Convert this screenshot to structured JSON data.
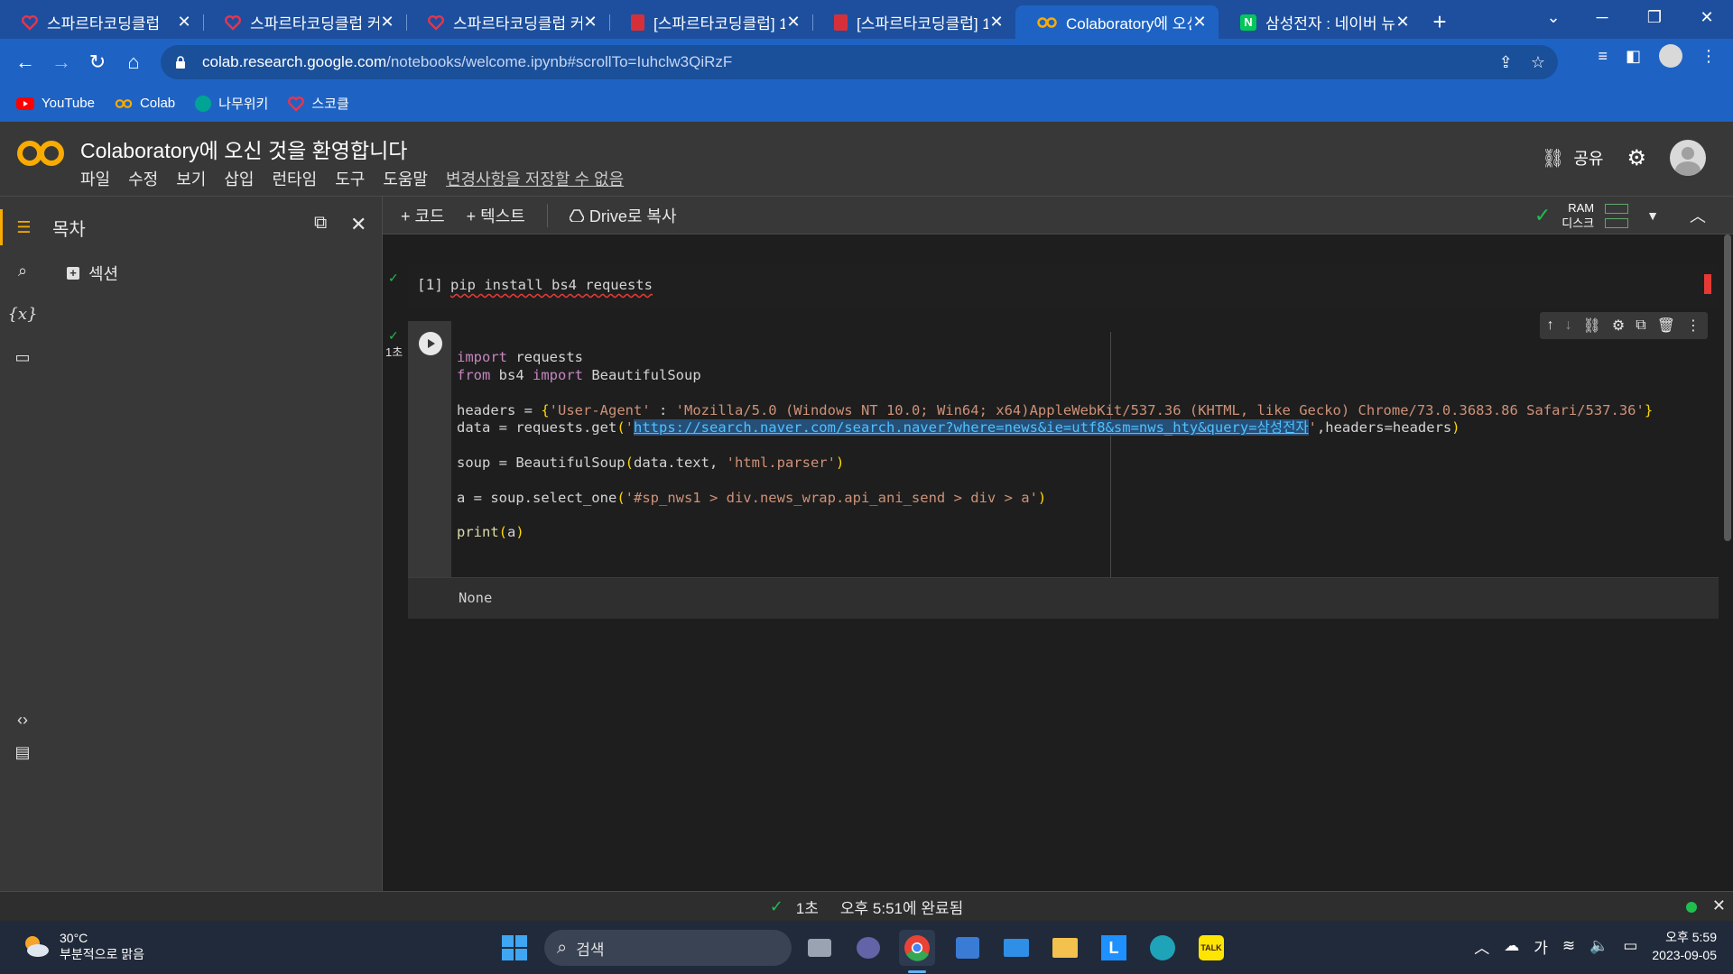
{
  "browser": {
    "tabs": [
      {
        "title": "스파르타코딩클럽",
        "icon": "sparta-heart-icon"
      },
      {
        "title": "스파르타코딩클럽 커",
        "icon": "sparta-heart-icon"
      },
      {
        "title": "스파르타코딩클럽 커",
        "icon": "sparta-heart-icon"
      },
      {
        "title": "[스파르타코딩클럽] 1",
        "icon": "red-doc-icon"
      },
      {
        "title": "[스파르타코딩클럽] 1",
        "icon": "red-doc-icon"
      },
      {
        "title": "Colaboratory에 오신",
        "icon": "colab-icon",
        "active": true
      },
      {
        "title": "삼성전자 : 네이버 뉴",
        "icon": "naver-icon"
      }
    ],
    "url_host": "colab.research.google.com",
    "url_path": "/notebooks/welcome.ipynb#scrollTo=Iuhclw3QiRzF",
    "bookmarks": [
      "YouTube",
      "Colab",
      "나무위키",
      "스코클"
    ]
  },
  "colab": {
    "title": "Colaboratory에 오신 것을 환영합니다",
    "menu": [
      "파일",
      "수정",
      "보기",
      "삽입",
      "런타임",
      "도구",
      "도움말"
    ],
    "unsaved": "변경사항을 저장할 수 없음",
    "share": "공유"
  },
  "toc": {
    "title": "목차",
    "section": "섹션"
  },
  "toolbar": {
    "add_code": "+ 코드",
    "add_text": "+ 텍스트",
    "copy_drive": "Drive로 복사",
    "ram": "RAM",
    "disk": "디스크"
  },
  "cells": {
    "cell1_count": "[1]",
    "cell1_code": "pip install bs4 requests",
    "cell2_time": "1초",
    "cell2_output": "None",
    "cell2_lines": {
      "l1_kw": "import",
      "l1_rest": " requests",
      "l2_kw1": "from",
      "l2_mid": " bs4 ",
      "l2_kw2": "import",
      "l2_rest": " BeautifulSoup",
      "l4_a": "headers = ",
      "l4_br1": "{",
      "l4_s1": "'User-Agent'",
      "l4_b": " : ",
      "l4_s2": "'Mozilla/5.0 (Windows NT 10.0; Win64; x64)AppleWebKit/537.36 (KHTML, like Gecko) Chrome/73.0.3683.86 Safari/537.36'",
      "l4_br2": "}",
      "l5_a": "data = requests.get",
      "l5_br1": "(",
      "l5_q1": "'",
      "l5_url": "https://search.naver.com/search.naver?where=news&ie=utf8&sm=nws_hty&query=삼성전자",
      "l5_q2": "'",
      "l5_b": ",headers=headers",
      "l5_br2": ")",
      "l7_a": "soup = BeautifulSoup",
      "l7_br1": "(",
      "l7_b": "data.text, ",
      "l7_s": "'html.parser'",
      "l7_br2": ")",
      "l9_a": "a = soup.select_one",
      "l9_br1": "(",
      "l9_s": "'#sp_nws1 > div.news_wrap.api_ani_send > div > a'",
      "l9_br2": ")",
      "l11_fn": "print",
      "l11_br1": "(",
      "l11_a": "a",
      "l11_br2": ")"
    }
  },
  "status": {
    "time": "1초",
    "done": "오후 5:51에 완료됨"
  },
  "taskbar": {
    "temp": "30°C",
    "weather": "부분적으로 맑음",
    "search": "검색",
    "ime": "가",
    "time": "오후 5:59",
    "date": "2023-09-05"
  },
  "colors": {
    "chrome_blue": "#1e63c4",
    "colab_orange": "#f9ab00",
    "editor_bg": "#1e1e1e"
  }
}
